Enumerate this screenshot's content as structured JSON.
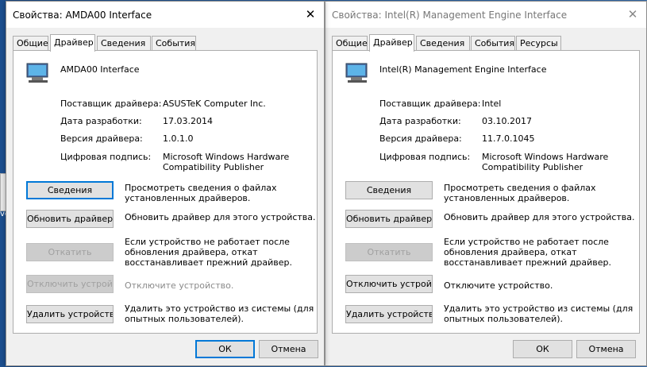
{
  "desktop": {
    "partial_label": "ve"
  },
  "windows": [
    {
      "title": "Свойства: AMDA00 Interface",
      "close": "✕",
      "tabs": [
        "Общие",
        "Драйвер",
        "Сведения",
        "События"
      ],
      "active_tab": "Драйвер",
      "device_name": "AMDA00 Interface",
      "provider_label": "Поставщик драйвера:",
      "provider": "ASUSTeK Computer Inc.",
      "date_label": "Дата разработки:",
      "date": "17.03.2014",
      "version_label": "Версия драйвера:",
      "version": "1.0.1.0",
      "signer_label": "Цифровая подпись:",
      "signer_line1": "Microsoft Windows Hardware",
      "signer_line2": "Compatibility Publisher",
      "details_button": "Сведения",
      "details_desc1": "Просмотреть сведения о файлах",
      "details_desc2": "установленных драйверов.",
      "update_button": "Обновить драйвер",
      "update_desc": "Обновить драйвер для этого устройства.",
      "rollback_button": "Откатить",
      "rollback_desc1": "Если устройство не работает после",
      "rollback_desc2": "обновления драйвера, откат",
      "rollback_desc3": "восстанавливает прежний драйвер.",
      "disable_button": "Отключить устройство",
      "disable_desc": "Отключите устройство.",
      "uninstall_button": "Удалить устройство",
      "uninstall_desc1": "Удалить это устройство из системы (для",
      "uninstall_desc2": "опытных пользователей).",
      "ok": "ОК",
      "cancel": "Отмена"
    },
    {
      "title": "Свойства: Intel(R) Management Engine Interface",
      "close": "✕",
      "tabs": [
        "Общие",
        "Драйвер",
        "Сведения",
        "События",
        "Ресурсы"
      ],
      "active_tab": "Драйвер",
      "device_name": "Intel(R) Management Engine Interface",
      "provider_label": "Поставщик драйвера:",
      "provider": "Intel",
      "date_label": "Дата разработки:",
      "date": "03.10.2017",
      "version_label": "Версия драйвера:",
      "version": "11.7.0.1045",
      "signer_label": "Цифровая подпись:",
      "signer_line1": "Microsoft Windows Hardware",
      "signer_line2": "Compatibility Publisher",
      "details_button": "Сведения",
      "details_desc1": "Просмотреть сведения о файлах",
      "details_desc2": "установленных драйверов.",
      "update_button": "Обновить драйвер",
      "update_desc": "Обновить драйвер для этого устройства.",
      "rollback_button": "Откатить",
      "rollback_desc1": "Если устройство не работает после",
      "rollback_desc2": "обновления драйвера, откат",
      "rollback_desc3": "восстанавливает прежний драйвер.",
      "disable_button": "Отключить устройство",
      "disable_desc": "Отключите устройство.",
      "uninstall_button": "Удалить устройство",
      "uninstall_desc1": "Удалить это устройство из системы (для",
      "uninstall_desc2": "опытных пользователей).",
      "ok": "ОК",
      "cancel": "Отмена"
    }
  ],
  "colors": {
    "focus": "#0078d7",
    "disabled_text": "#a0a0a0",
    "desktop": "#2a66ad"
  }
}
